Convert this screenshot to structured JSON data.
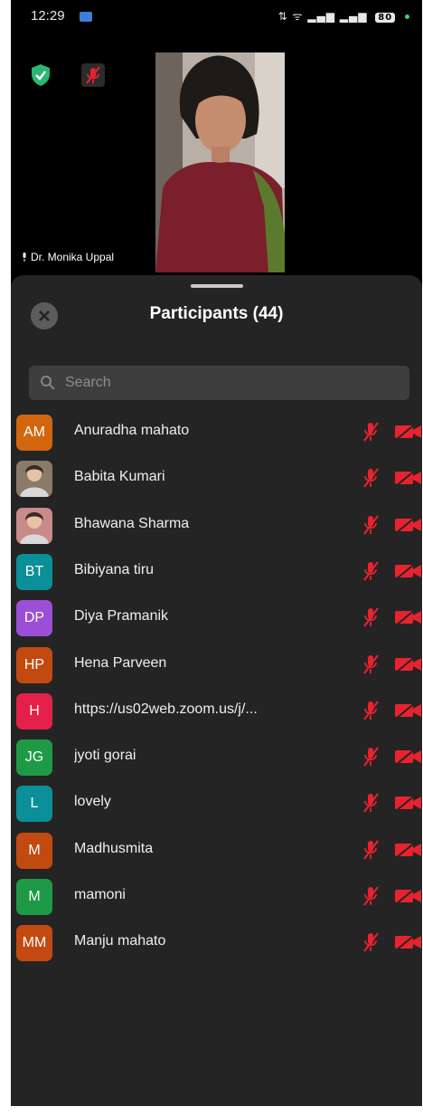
{
  "status_bar": {
    "time": "12:29",
    "right_indicators": "⇅ ᯤ ▂▄▆ ▂▄▆",
    "battery": "80"
  },
  "video": {
    "speaker_name": "Dr. Monika Uppal"
  },
  "participants_panel": {
    "title": "Participants (44)",
    "search_placeholder": "Search",
    "items": [
      {
        "initials": "AM",
        "name": "Anuradha mahato",
        "color": "#d2660f",
        "photo": false
      },
      {
        "initials": "",
        "name": "Babita Kumari",
        "color": "#8a7a6a",
        "photo": true
      },
      {
        "initials": "",
        "name": "Bhawana Sharma",
        "color": "#c98a8a",
        "photo": true
      },
      {
        "initials": "BT",
        "name": "Bibiyana tiru",
        "color": "#0b8f98",
        "photo": false
      },
      {
        "initials": "DP",
        "name": "Diya Pramanik",
        "color": "#9b4ed6",
        "photo": false
      },
      {
        "initials": "HP",
        "name": "Hena Parveen",
        "color": "#c24a10",
        "photo": false
      },
      {
        "initials": "H",
        "name": "https://us02web.zoom.us/j/...",
        "color": "#e32148",
        "photo": false
      },
      {
        "initials": "JG",
        "name": "jyoti gorai",
        "color": "#1e9a46",
        "photo": false
      },
      {
        "initials": "L",
        "name": "lovely",
        "color": "#0b8f98",
        "photo": false
      },
      {
        "initials": "M",
        "name": "Madhusmita",
        "color": "#c24a10",
        "photo": false
      },
      {
        "initials": "M",
        "name": "mamoni",
        "color": "#1e9a46",
        "photo": false
      },
      {
        "initials": "MM",
        "name": "Manju mahato",
        "color": "#c24a10",
        "photo": false
      }
    ]
  },
  "colors": {
    "muted_red": "#e8232f",
    "panel_bg": "#242424",
    "shield_green": "#2bb673"
  }
}
